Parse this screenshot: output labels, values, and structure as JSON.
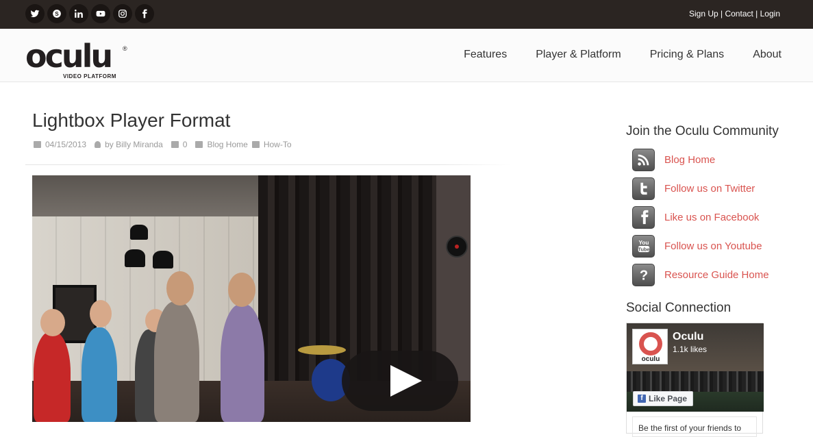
{
  "topbar": {
    "social": [
      "twitter-icon",
      "skype-icon",
      "linkedin-icon",
      "youtube-icon",
      "instagram-icon",
      "facebook-icon"
    ],
    "links": {
      "signup": "Sign Up",
      "contact": "Contact",
      "login": "Login",
      "sep": " | "
    }
  },
  "logo": {
    "word": "oculu",
    "reg": "®",
    "sub": "VIDEO PLATFORM"
  },
  "nav": [
    "Features",
    "Player & Platform",
    "Pricing & Plans",
    "About"
  ],
  "post": {
    "title": "Lightbox Player Format",
    "date": "04/15/2013",
    "author": "by Billy Miranda",
    "comments": "0",
    "category1": "Blog Home",
    "category2": "How-To"
  },
  "sidebar": {
    "community_title": "Join the Oculu Community",
    "items": [
      {
        "icon": "rss-icon",
        "label": "Blog Home"
      },
      {
        "icon": "twitter-icon",
        "label": "Follow us on Twitter"
      },
      {
        "icon": "facebook-icon",
        "label": "Like us on Facebook"
      },
      {
        "icon": "youtube-icon",
        "label": "Follow us on Youtube"
      },
      {
        "icon": "question-icon",
        "label": "Resource Guide Home"
      }
    ],
    "social_title": "Social Connection",
    "fb": {
      "name": "Oculu",
      "likes": "1.1k likes",
      "logo_text": "oculu",
      "like_button": "Like Page",
      "footer": "Be the first of your friends to"
    }
  },
  "colors": {
    "accent": "#d9534f",
    "topbar": "#2b2522"
  }
}
